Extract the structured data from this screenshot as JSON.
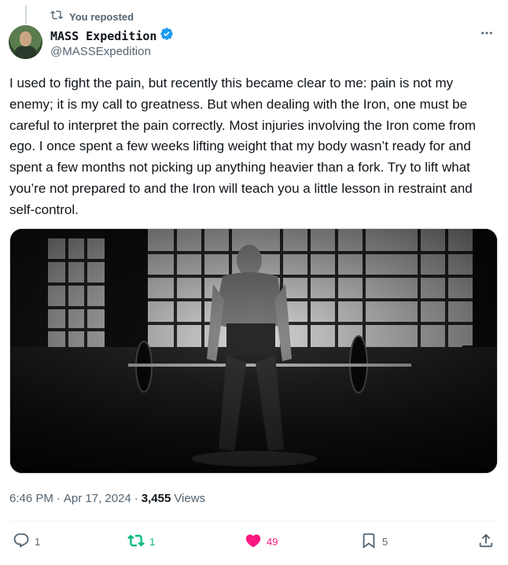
{
  "repost": {
    "label": "You reposted"
  },
  "author": {
    "display_name": "MASS Expedition",
    "handle": "@MASSExpedition",
    "verified": true
  },
  "tweet": {
    "text": "I used to fight the pain, but recently this became clear to me: pain is not my enemy; it is my call to greatness. But when dealing with the Iron, one must be careful to interpret the pain correctly. Most injuries involving the Iron come from ego. I once spent a few weeks lifting weight that my body wasn’t ready for and spent a few months not picking up anything heavier than a fork. Try to lift what you’re not prepared to and the Iron will teach you a little lesson in restraint and self-control."
  },
  "meta": {
    "time": "6:46 PM",
    "separator": "·",
    "date": "Apr 17, 2024",
    "views_count": "3,455",
    "views_label": "Views"
  },
  "actions": {
    "replies": "1",
    "reposts": "1",
    "likes": "49",
    "bookmarks": "5"
  },
  "colors": {
    "verified": "#1d9bf0",
    "repost_active": "#00ba7c",
    "like_active": "#f91880",
    "muted": "#536471"
  }
}
